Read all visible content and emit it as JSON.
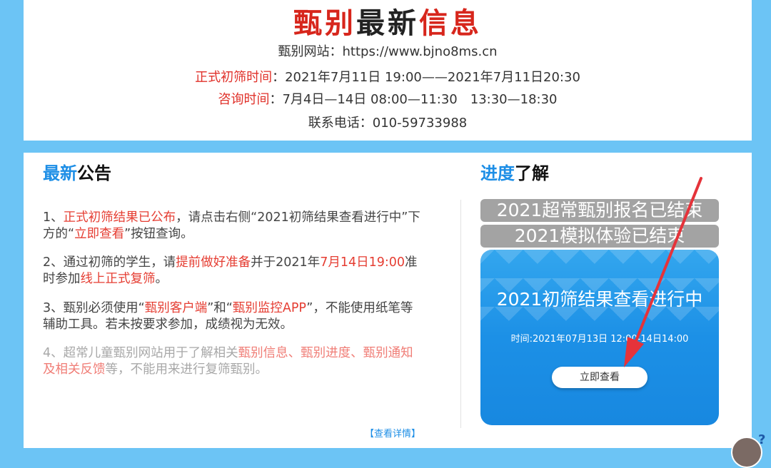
{
  "header": {
    "title_part1": "甄别",
    "title_part2": "最新",
    "title_part3": "信息",
    "website_label": "甄别网站：",
    "website_url": "https://www.bjno8ms.cn",
    "screening_time_label": "正式初筛时间",
    "screening_time_value": "：2021年7月11日 19:00——2021年7月11日20:30",
    "consult_time_label": "咨询时间",
    "consult_time_value": "：7月4日—14日 08:00—11:30　13:30—18:30",
    "phone": "联系电话：010-59733988"
  },
  "announcements": {
    "heading_blue": "最新",
    "heading_dark": "公告",
    "items": [
      {
        "p1": "1、",
        "h1": "正式初筛结果已公布",
        "p2": "，请点击右侧“2021初筛结果查看进行中”下方的“",
        "h2": "立即查看",
        "p3": "”按钮查询。"
      },
      {
        "p1": "2、通过初筛的学生，请",
        "h1": "提前做好准备",
        "p2": "并于2021年",
        "h2": "7月14日19:00",
        "p3": "准时参加",
        "h3": "线上正式复筛",
        "p4": "。"
      },
      {
        "p1": "3、甄别必须使用“",
        "h1": "甄别客户端",
        "p2": "”和“",
        "h2": "甄别监控APP",
        "p3": "”，不能使用纸笔等辅助工具。若未按要求参加，成绩视为无效。"
      },
      {
        "p1": "4、超常儿童甄别网站用于了解相关",
        "h1": "甄别信息、甄别进度、甄别通知及相关反馈",
        "p2": "等，不能用来进行复筛甄别。"
      }
    ],
    "details_link": "【查看详情】"
  },
  "progress": {
    "heading_blue": "进度",
    "heading_dark": "了解",
    "status_bars": [
      "2021超常甄别报名已结束",
      "2021模拟体验已结束"
    ],
    "card_title": "2021初筛结果查看进行中",
    "card_time": "时间:2021年07月13日 12:00-14日14:00",
    "button_label": "立即查看"
  },
  "colors": {
    "background": "#6cc4f5",
    "title_red": "#d7261c",
    "highlight_red": "#e53d32",
    "heading_blue": "#1d8ee6",
    "card_blue": "#1c90e6",
    "status_gray": "#a3a3a3",
    "arrow_red": "#e5333a"
  },
  "icons": {
    "help": "help-question-icon",
    "arrow": "red-pointer-arrow"
  }
}
